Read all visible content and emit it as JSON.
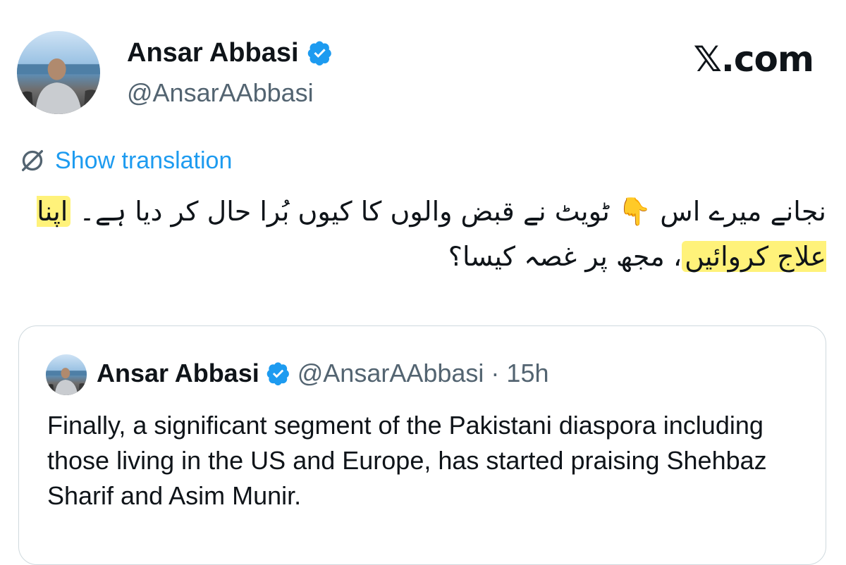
{
  "tweet": {
    "author_name": "Ansar Abbasi",
    "author_handle": "@AnsarAAbbasi",
    "brand": "𝕏.com",
    "show_translation": "Show translation",
    "urdu_part1": "نجانے میرے اس 👇 ٹویٹ  نے قبض والوں کا کیوں بُرا حال کر دیا ہے۔ ",
    "urdu_highlight": "اپنا علاج کروائیں",
    "urdu_part2": "، مجھ پر غصہ کیسا؟"
  },
  "quoted": {
    "author_name": "Ansar Abbasi",
    "author_handle": "@AnsarAAbbasi",
    "separator": "·",
    "time": "15h",
    "text": "Finally, a significant segment of the Pakistani diaspora including those living in the US and Europe, has started praising Shehbaz Sharif and Asim Munir."
  },
  "colors": {
    "accent": "#1d9bf0",
    "highlight": "#fff27a",
    "secondary_text": "#536471"
  },
  "icons": [
    "verified-badge-icon",
    "translate-icon"
  ]
}
